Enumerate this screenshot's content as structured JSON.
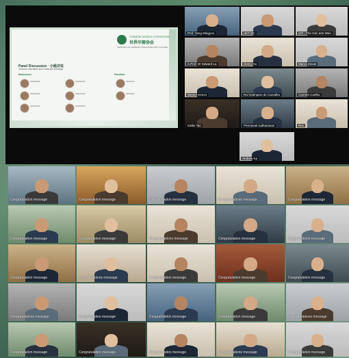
{
  "slide": {
    "logo_line1": "CHINESE WORLD LITERATURE",
    "logo_line2": "世界华裔协会",
    "logo_line3": "SEMINAR ON CHINESE LITERATURE AND CULTURE",
    "panel_title": "Panel Discussion · 小组讨论",
    "panel_subtitle": "Chinese Literature and Cultural Exchange",
    "group_a": "Moderators",
    "group_b": "Panelists"
  },
  "top_tiles": [
    {
      "label": "Prof. Yang Mingyou"
    },
    {
      "label": "HKT DC"
    },
    {
      "label": "CIT - The Gen arts Wee"
    },
    {
      "label": "A.Prof. Dr Edward La"
    },
    {
      "label": "Henry Ho"
    },
    {
      "label": "Marco Zecan"
    },
    {
      "label": "Steven Kenzo"
    },
    {
      "label": "Rui Gulmpton de Carvalho"
    },
    {
      "label": "Carmen Coelho"
    },
    {
      "label": "Eddie Tan"
    },
    {
      "label": "Permavati Kalhanasari"
    },
    {
      "label": "Rex"
    },
    {
      "label": "Andrew Ka"
    }
  ],
  "grid": {
    "caption": "Congratulation message",
    "caption_alt": "Congratulations message"
  }
}
